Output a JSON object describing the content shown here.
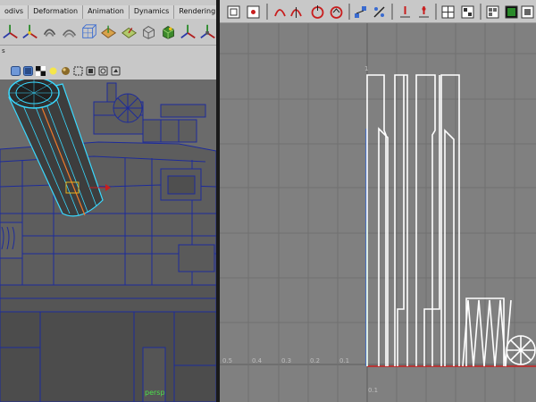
{
  "menu": {
    "tabs": [
      "odivs",
      "Deformation",
      "Animation",
      "Dynamics",
      "Rendering"
    ]
  },
  "shelf": {
    "icons": [
      "transform-gizmo-icon",
      "scale-gizmo-icon",
      "rotate-gizmo-icon",
      "soft-mod-icon",
      "soft-select-icon",
      "lattice-cube-icon",
      "snap-plane-icon",
      "bend-deformer-icon",
      "wire-box-icon",
      "cluster-icon",
      "joint-gizmo-icon",
      "constraint-gizmo-icon"
    ]
  },
  "panel": {
    "label": "s"
  },
  "viewport": {
    "camera_label": "persp",
    "selection_color": "#39d9ff",
    "wire_color": "#1d2b9a"
  },
  "graph_editor": {
    "axis_x_labels": [
      "0.5",
      "0.4",
      "0.3",
      "0.2",
      "0.1"
    ],
    "axis_y_top_label": "1",
    "axis_y_below_label": "0.1",
    "curve_color": "#ffffff",
    "grid_color": "#707070",
    "background_color": "#808080"
  }
}
